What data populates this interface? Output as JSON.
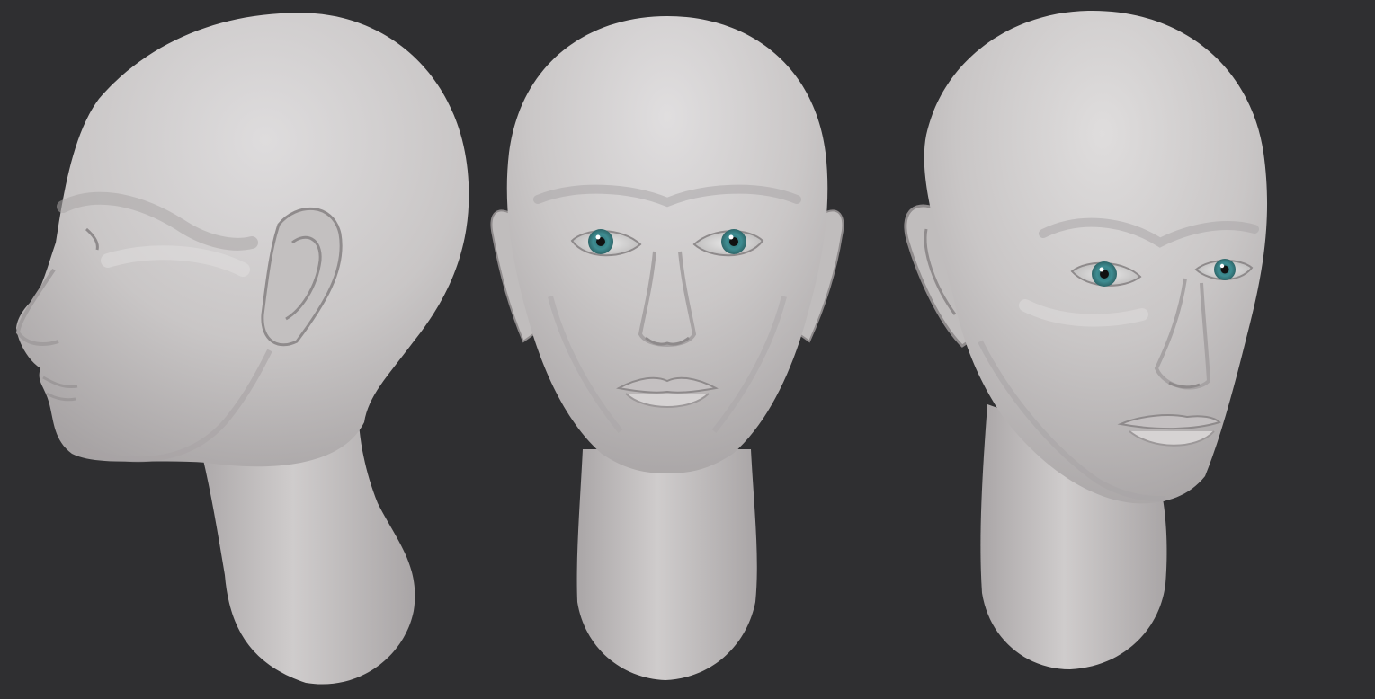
{
  "scene": {
    "background_color": "#2f2f31",
    "skin_color": "#c9c6c6",
    "skin_highlight_color": "#dedcdd",
    "skin_shadow_color": "#9e9a9b",
    "iris_color": "#3f8d92",
    "views": [
      "side-profile",
      "front",
      "three-quarter"
    ]
  }
}
